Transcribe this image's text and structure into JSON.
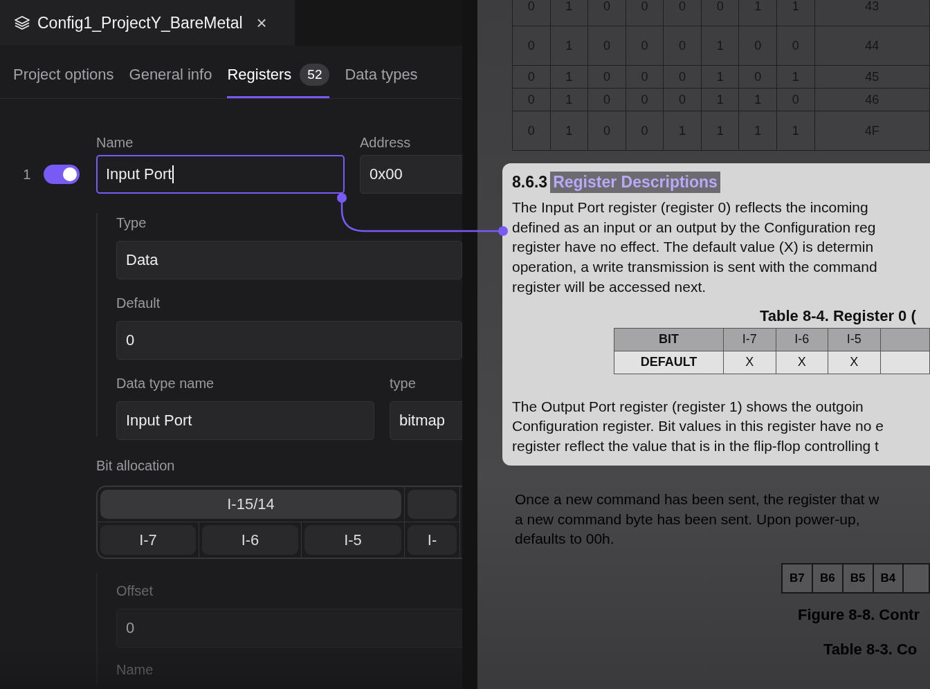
{
  "window": {
    "title": "Config1_ProjectY_BareMetal",
    "close_label": "×"
  },
  "tabs": [
    {
      "label": "Project options",
      "selected": false
    },
    {
      "label": "General info",
      "selected": false
    },
    {
      "label": "Registers",
      "badge": "52",
      "selected": true
    },
    {
      "label": "Data types",
      "selected": false
    }
  ],
  "register": {
    "index": "1",
    "enabled": true,
    "name_label": "Name",
    "name_value": "Input Port",
    "address_label": "Address",
    "address_value": "0x00",
    "type_label": "Type",
    "type_value": "Data",
    "default_label": "Default",
    "default_value": "0",
    "data_type_name_label": "Data type name",
    "data_type_name_value": "Input Port",
    "data_type_label": "type",
    "data_type_value": "bitmap"
  },
  "bit_allocation": {
    "label": "Bit allocation",
    "top_row": [
      "I-15/14"
    ],
    "bottom_row": [
      "I-7",
      "I-6",
      "I-5",
      "I-"
    ]
  },
  "offset": {
    "label": "Offset",
    "value": "0",
    "next_label": "Name"
  },
  "document": {
    "bit_table": [
      [
        "0",
        "1",
        "0",
        "0",
        "0",
        "0",
        "1",
        "1",
        "43"
      ],
      [
        "0",
        "1",
        "0",
        "0",
        "0",
        "1",
        "0",
        "0",
        "44"
      ],
      [
        "0",
        "1",
        "0",
        "0",
        "0",
        "1",
        "0",
        "1",
        "45"
      ],
      [
        "0",
        "1",
        "0",
        "0",
        "0",
        "1",
        "1",
        "0",
        "46"
      ],
      [
        "0",
        "1",
        "0",
        "0",
        "1",
        "1",
        "1",
        "1",
        "4F"
      ]
    ],
    "section_number": "8.6.3",
    "section_title": "Register Descriptions",
    "paragraph_1": [
      "The Input Port register (register 0) reflects the incoming",
      "defined as an input or an output by the Configuration reg",
      "register have no effect. The default value (X) is determin",
      "operation, a write transmission is sent with the command",
      "register will be accessed next."
    ],
    "table_caption": "Table 8-4. Register 0 (",
    "register_table": {
      "header": [
        "BIT",
        "I-7",
        "I-6",
        "I-5"
      ],
      "rows": [
        [
          "DEFAULT",
          "X",
          "X",
          "X"
        ]
      ]
    },
    "paragraph_2": [
      "The Output Port register (register 1) shows the outgoin",
      "Configuration register. Bit values in this register have no e",
      "register reflect the value that is in the flip-flop controlling t"
    ],
    "paragraph_3": [
      "Once a new command has been sent, the register that w",
      "a new command byte has been sent. Upon power-up,",
      "defaults to 00h."
    ],
    "figure_bits": [
      "B7",
      "B6",
      "B5",
      "B4"
    ],
    "figure_caption": "Figure 8-8. Contr",
    "table_caption_2": "Table 8-3. Co"
  }
}
